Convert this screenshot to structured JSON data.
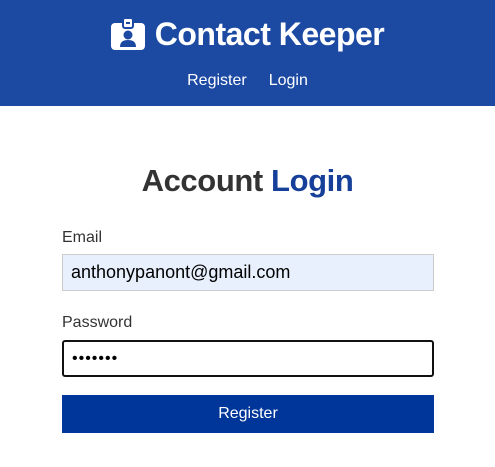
{
  "navbar": {
    "brand_icon": "id-badge-icon",
    "title": "Contact Keeper",
    "links": [
      {
        "label": "Register"
      },
      {
        "label": "Login"
      }
    ]
  },
  "login_form": {
    "heading_prefix": "Account",
    "heading_accent": "Login",
    "email": {
      "label": "Email",
      "value": "anthonypanont@gmail.com"
    },
    "password": {
      "label": "Password",
      "value": "•••••••"
    },
    "submit_label": "Register"
  },
  "colors": {
    "navbar_background": "#1c4aa3",
    "heading_accent": "#163f99",
    "button_background": "#003699",
    "autofill_background": "#e8f0fe"
  }
}
